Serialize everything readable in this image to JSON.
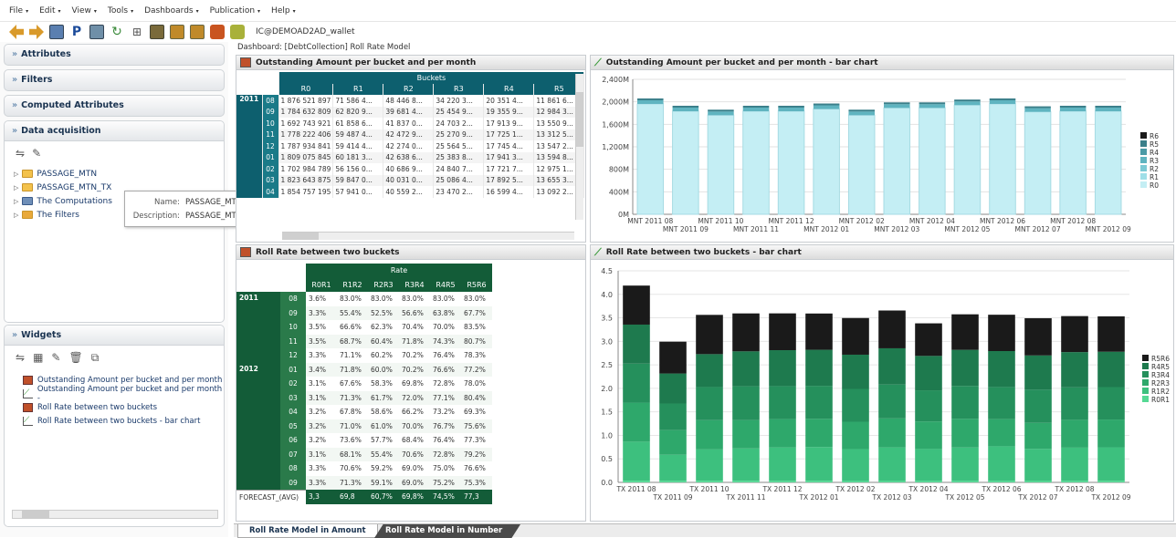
{
  "menu": [
    "File",
    "Edit",
    "View",
    "Tools",
    "Dashboards",
    "Publication",
    "Help"
  ],
  "toolbar": {
    "wallet": "IC@DEMOAD2AD_wallet"
  },
  "left": {
    "attributes": "Attributes",
    "filters": "Filters",
    "computed": "Computed Attributes",
    "data_acq": "Data acquisition",
    "tree": [
      "PASSAGE_MTN",
      "PASSAGE_MTN_TX",
      "The Computations",
      "The Filters"
    ],
    "tooltip": {
      "name_label": "Name:",
      "name": "PASSAGE_MTN_TX",
      "desc_label": "Description:",
      "desc": "PASSAGE_MTN_TX"
    },
    "widgets": "Widgets",
    "widget_items": [
      "Outstanding Amount per bucket and per month",
      "Outstanding Amount per bucket and per month -",
      "Roll Rate between two buckets",
      "Roll Rate between two buckets - bar chart"
    ]
  },
  "dashboard_label": "Dashboard: [DebtCollection] Roll Rate Model",
  "panels": {
    "p1": "Outstanding Amount per bucket and per month",
    "p2": "Outstanding Amount per bucket and per month - bar chart",
    "p3": "Roll Rate between two buckets",
    "p4": "Roll Rate between two buckets - bar chart"
  },
  "table1": {
    "group": "Buckets",
    "cols": [
      "R0",
      "R1",
      "R2",
      "R3",
      "R4",
      "R5"
    ],
    "year": "2011",
    "months": [
      "08",
      "09",
      "10",
      "11",
      "12",
      "01",
      "02",
      "03",
      "04"
    ],
    "rows": [
      [
        "1 876 521 897",
        "71 586 4...",
        "48 446 8...",
        "34 220 3...",
        "20 351 4...",
        "11 861 6..."
      ],
      [
        "1 784 632 809",
        "62 820 9...",
        "39 681 4...",
        "25 454 9...",
        "19 355 9...",
        "12 984 3..."
      ],
      [
        "1 692 743 921",
        "61 858 6...",
        "41 837 0...",
        "24 703 2...",
        "17 913 9...",
        "13 550 9..."
      ],
      [
        "1 778 222 406",
        "59 487 4...",
        "42 472 9...",
        "25 270 9...",
        "17 725 1...",
        "13 312 5..."
      ],
      [
        "1 787 934 841",
        "59 414 4...",
        "42 274 0...",
        "25 564 5...",
        "17 745 4...",
        "13 547 2..."
      ],
      [
        "1 809 075 845",
        "60 181 3...",
        "42 638 6...",
        "25 383 8...",
        "17 941 3...",
        "13 594 8..."
      ],
      [
        "1 702 984 789",
        "56 156 0...",
        "40 686 9...",
        "24 840 7...",
        "17 721 7...",
        "12 975 1..."
      ],
      [
        "1 823 643 875",
        "59 847 0...",
        "40 031 0...",
        "25 086 4...",
        "17 892 5...",
        "13 655 3..."
      ],
      [
        "1 854 757 195",
        "57 941 0...",
        "40 559 2...",
        "23 470 2...",
        "16 599 4...",
        "13 092 2..."
      ]
    ]
  },
  "table2": {
    "group": "Rate",
    "cols": [
      "R0R1",
      "R1R2",
      "R2R3",
      "R3R4",
      "R4R5",
      "R5R6"
    ],
    "years": [
      {
        "year": "2011",
        "months": [
          "08",
          "09",
          "10",
          "11",
          "12"
        ]
      },
      {
        "year": "2012",
        "months": [
          "01",
          "02",
          "03",
          "04",
          "05",
          "06",
          "07",
          "08",
          "09"
        ]
      }
    ],
    "rows": [
      [
        "3.6%",
        "83.0%",
        "83.0%",
        "83.0%",
        "83.0%",
        "83.0%"
      ],
      [
        "3.3%",
        "55.4%",
        "52.5%",
        "56.6%",
        "63.8%",
        "67.7%"
      ],
      [
        "3.5%",
        "66.6%",
        "62.3%",
        "70.4%",
        "70.0%",
        "83.5%"
      ],
      [
        "3.5%",
        "68.7%",
        "60.4%",
        "71.8%",
        "74.3%",
        "80.7%"
      ],
      [
        "3.3%",
        "71.1%",
        "60.2%",
        "70.2%",
        "76.4%",
        "78.3%"
      ],
      [
        "3.4%",
        "71.8%",
        "60.0%",
        "70.2%",
        "76.6%",
        "77.2%"
      ],
      [
        "3.1%",
        "67.6%",
        "58.3%",
        "69.8%",
        "72.8%",
        "78.0%"
      ],
      [
        "3.1%",
        "71.3%",
        "61.7%",
        "72.0%",
        "77.1%",
        "80.4%"
      ],
      [
        "3.2%",
        "67.8%",
        "58.6%",
        "66.2%",
        "73.2%",
        "69.3%"
      ],
      [
        "3.2%",
        "71.0%",
        "61.0%",
        "70.0%",
        "76.7%",
        "75.6%"
      ],
      [
        "3.2%",
        "73.6%",
        "57.7%",
        "68.4%",
        "76.4%",
        "77.3%"
      ],
      [
        "3.1%",
        "68.1%",
        "55.4%",
        "70.6%",
        "72.8%",
        "79.2%"
      ],
      [
        "3.3%",
        "70.6%",
        "59.2%",
        "69.0%",
        "75.0%",
        "76.6%"
      ],
      [
        "3.3%",
        "71.3%",
        "59.1%",
        "69.0%",
        "75.2%",
        "75.3%"
      ]
    ],
    "forecast_label": "FORECAST_(AVG)",
    "forecast": [
      "3,3",
      "69,8",
      "60,7%",
      "69,8%",
      "74,5%",
      "77,3"
    ]
  },
  "chart_data": [
    {
      "type": "bar",
      "title": "Outstanding Amount per bucket and per month - bar chart",
      "categories": [
        "MNT 2011 08",
        "MNT 2011 09",
        "MNT 2011 10",
        "MNT 2011 11",
        "MNT 2011 12",
        "MNT 2012 01",
        "MNT 2012 02",
        "MNT 2012 03",
        "MNT 2012 04",
        "MNT 2012 05",
        "MNT 2012 06",
        "MNT 2012 07",
        "MNT 2012 08",
        "MNT 2012 09"
      ],
      "yticks": [
        "0M",
        "400M",
        "800M",
        "1,200M",
        "1,600M",
        "2,000M",
        "2,400M"
      ],
      "ylim": [
        0,
        2400
      ],
      "legend": [
        "R6",
        "R5",
        "R4",
        "R3",
        "R2",
        "R1",
        "R0"
      ],
      "colors": [
        "#1a1a1a",
        "#3a7f8a",
        "#4a9aa6",
        "#5fb4c0",
        "#7ccad5",
        "#9fdfe8",
        "#c4eef4"
      ],
      "totals": [
        2060,
        1930,
        1860,
        1930,
        1930,
        1970,
        1860,
        1990,
        1990,
        2040,
        2060,
        1920,
        1930,
        1930
      ]
    },
    {
      "type": "bar",
      "title": "Roll Rate between two buckets - bar chart",
      "categories": [
        "TX 2011 08",
        "TX 2011 09",
        "TX 2011 10",
        "TX 2011 11",
        "TX 2011 12",
        "TX 2012 01",
        "TX 2012 02",
        "TX 2012 03",
        "TX 2012 04",
        "TX 2012 05",
        "TX 2012 06",
        "TX 2012 07",
        "TX 2012 08",
        "TX 2012 09"
      ],
      "yticks": [
        "0.0",
        "0.5",
        "1.0",
        "1.5",
        "2.0",
        "2.5",
        "3.0",
        "3.5",
        "4.0",
        "4.5"
      ],
      "ylim": [
        0,
        4.5
      ],
      "legend": [
        "R5R6",
        "R4R5",
        "R3R4",
        "R2R3",
        "R1R2",
        "R0R1"
      ],
      "colors": [
        "#1a1a1a",
        "#1e7a4e",
        "#25905c",
        "#2ea86b",
        "#3dc07e",
        "#55d994"
      ],
      "series": [
        {
          "name": "R0R1",
          "values": [
            0.036,
            0.033,
            0.035,
            0.035,
            0.033,
            0.034,
            0.031,
            0.031,
            0.032,
            0.032,
            0.032,
            0.031,
            0.033,
            0.033
          ]
        },
        {
          "name": "R1R2",
          "values": [
            0.83,
            0.554,
            0.666,
            0.687,
            0.711,
            0.718,
            0.676,
            0.713,
            0.678,
            0.71,
            0.736,
            0.681,
            0.706,
            0.713
          ]
        },
        {
          "name": "R2R3",
          "values": [
            0.83,
            0.525,
            0.623,
            0.604,
            0.602,
            0.6,
            0.583,
            0.617,
            0.586,
            0.61,
            0.577,
            0.554,
            0.592,
            0.591
          ]
        },
        {
          "name": "R3R4",
          "values": [
            0.83,
            0.566,
            0.704,
            0.718,
            0.702,
            0.702,
            0.698,
            0.72,
            0.662,
            0.7,
            0.684,
            0.706,
            0.69,
            0.69
          ]
        },
        {
          "name": "R4R5",
          "values": [
            0.83,
            0.638,
            0.7,
            0.743,
            0.764,
            0.766,
            0.728,
            0.771,
            0.732,
            0.767,
            0.764,
            0.728,
            0.75,
            0.752
          ]
        },
        {
          "name": "R5R6",
          "values": [
            0.83,
            0.677,
            0.835,
            0.807,
            0.783,
            0.772,
            0.78,
            0.804,
            0.693,
            0.756,
            0.773,
            0.792,
            0.766,
            0.753
          ]
        }
      ]
    }
  ]
}
